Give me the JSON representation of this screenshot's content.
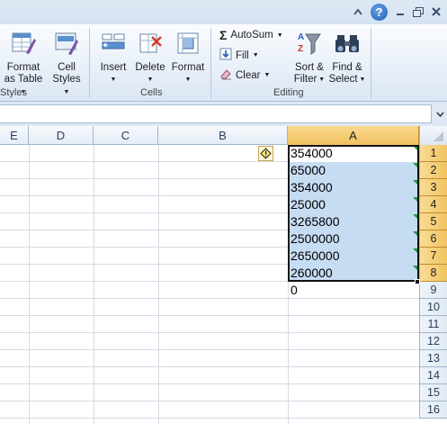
{
  "ribbon": {
    "styles_group": {
      "label": "Styles",
      "format_as_table": [
        "Format",
        "as Table"
      ],
      "cell_styles": [
        "Cell",
        "Styles"
      ]
    },
    "cells_group": {
      "label": "Cells",
      "insert": "Insert",
      "delete": "Delete",
      "format": "Format"
    },
    "editing_group": {
      "label": "Editing",
      "autosum": "AutoSum",
      "fill": "Fill",
      "clear": "Clear",
      "sort_filter": [
        "Sort &",
        "Filter"
      ],
      "find_select": [
        "Find &",
        "Select"
      ]
    }
  },
  "columns": [
    "E",
    "D",
    "C",
    "B",
    "A"
  ],
  "rows": [
    "1",
    "2",
    "3",
    "4",
    "5",
    "6",
    "7",
    "8",
    "9",
    "10",
    "11",
    "12",
    "13",
    "14",
    "15",
    "16"
  ],
  "cells": [
    "354000",
    "65000",
    "354000",
    "25000",
    "3265800",
    "2500000",
    "2650000",
    "260000",
    "0"
  ],
  "colors": {
    "selection_fill": "#c6dcf3",
    "header_selected": "#f1c15f",
    "error_triangle": "#1f9f3a"
  }
}
